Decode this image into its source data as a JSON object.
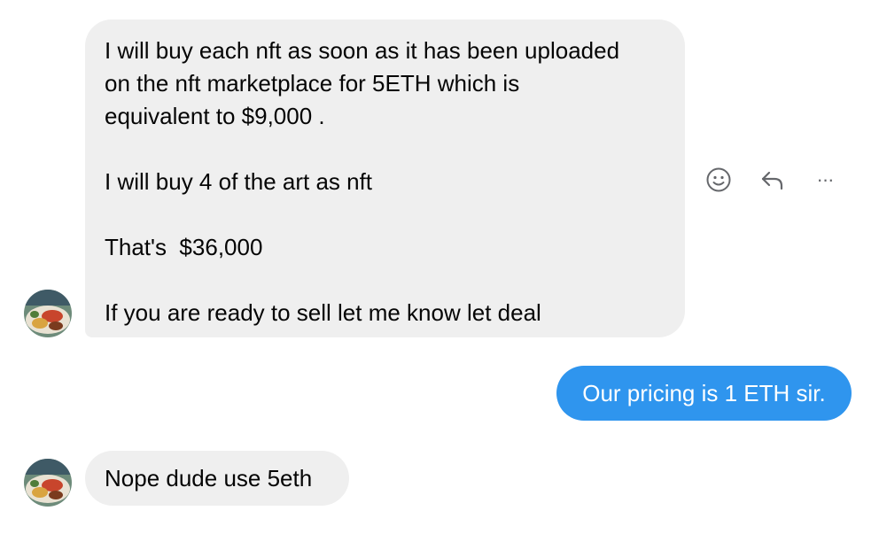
{
  "messages": [
    {
      "sender": "incoming",
      "paragraphs": [
        "I will buy each nft as soon as it has been uploaded\non the nft marketplace for 5ETH which is\nequivalent to $9,000 .",
        "I will buy 4 of the art as nft",
        "That's  $36,000",
        "If you are ready to sell let me know let deal"
      ]
    },
    {
      "sender": "outgoing",
      "text": "Our pricing is 1 ETH sir."
    },
    {
      "sender": "incoming",
      "text": "Nope dude use 5eth"
    }
  ],
  "message_actions": {
    "react_icon": "smiley-icon",
    "reply_icon": "reply-arrow-icon",
    "more_icon": "more-dots-icon",
    "more_label": "···"
  },
  "colors": {
    "incoming_bubble": "#efefef",
    "outgoing_bubble": "#2f95ee",
    "icon": "#65676b"
  }
}
